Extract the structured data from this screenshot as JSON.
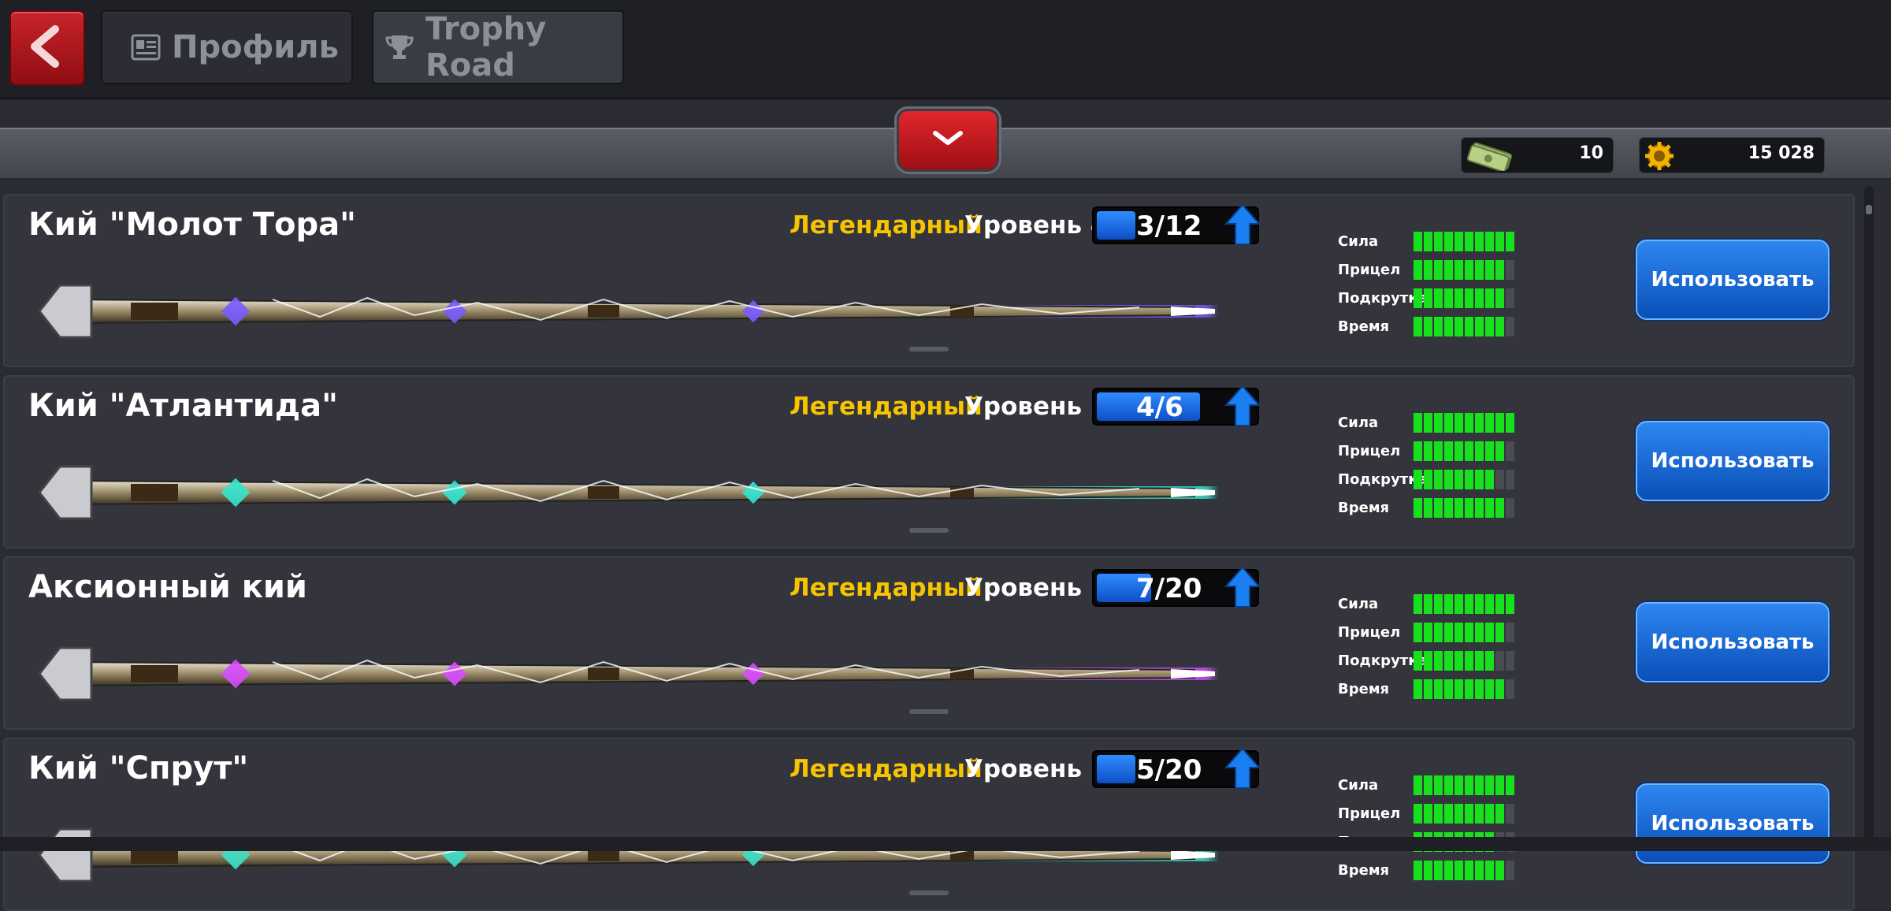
{
  "nav": {
    "back_icon": "chevron-left-icon",
    "tabs": [
      {
        "label": "Профиль",
        "icon": "profile-card-icon"
      },
      {
        "label": "Trophy Road",
        "icon": "trophy-icon"
      }
    ]
  },
  "currency": {
    "cash": {
      "value": "10",
      "icon": "cash-icon"
    },
    "coins": {
      "value": "15 028",
      "icon": "coin-icon"
    }
  },
  "stat_labels": [
    "Сила",
    "Прицел",
    "Подкрутка",
    "Время"
  ],
  "use_label": "Использовать",
  "colors": {
    "legendary": "#f6c400",
    "stat_on": "#17e01c",
    "button": "#1466d6"
  },
  "cues": [
    {
      "name": "Кий \"Молот Тора\"",
      "rarity": "Легендарный",
      "level": "Уровень 4",
      "progress": "3/12",
      "progress_fraction": 0.25,
      "stats": [
        10,
        9,
        9,
        9
      ],
      "glow": "#7a5cff"
    },
    {
      "name": "Кий \"Атлантида\"",
      "rarity": "Легендарный",
      "level": "Уровень 3",
      "progress": "4/6",
      "progress_fraction": 0.67,
      "stats": [
        10,
        9,
        8,
        9
      ],
      "glow": "#34e6d0"
    },
    {
      "name": "Аксионный кий",
      "rarity": "Легендарный",
      "level": "Уровень 5",
      "progress": "7/20",
      "progress_fraction": 0.35,
      "stats": [
        10,
        9,
        8,
        9
      ],
      "glow": "#d84cff"
    },
    {
      "name": "Кий \"Спрут\"",
      "rarity": "Легендарный",
      "level": "Уровень 5",
      "progress": "5/20",
      "progress_fraction": 0.25,
      "stats": [
        10,
        9,
        8,
        9
      ],
      "glow": "#3de0c8"
    }
  ]
}
